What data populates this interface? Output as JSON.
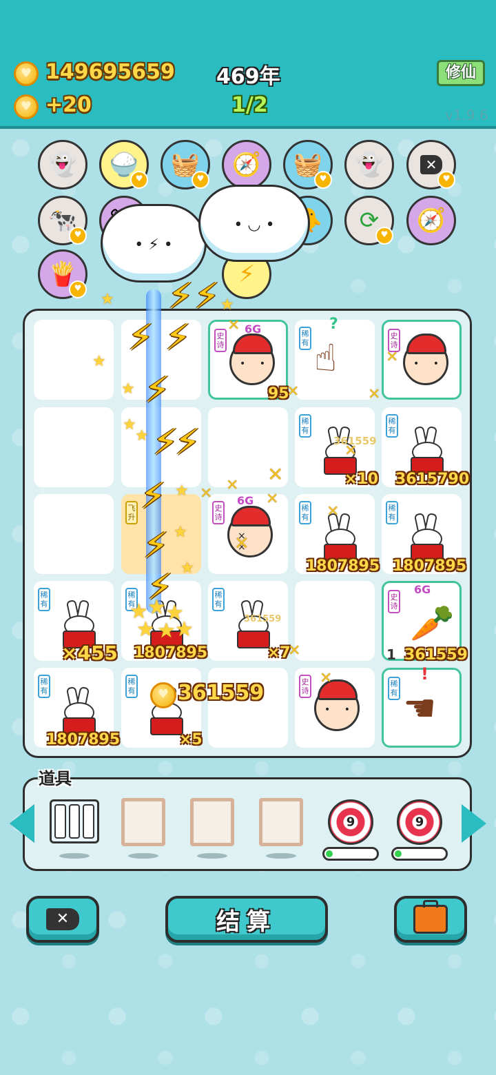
{
  "header": {
    "coins": "149695659",
    "income": "+20",
    "year": "469年",
    "wave": "1/2",
    "cultivate_label": "修仙",
    "version": "v1.9.6"
  },
  "skills": [
    {
      "icon": "ghost-icon",
      "color": "#e9e4e0"
    },
    {
      "icon": "rice-bowl-icon",
      "color": "#fff38a"
    },
    {
      "icon": "fruit-basket-icon",
      "color": "#7fd3ea"
    },
    {
      "icon": "compass-icon",
      "color": "#d3a7e8"
    },
    {
      "icon": "fruit-basket-icon",
      "color": "#7fd3ea"
    },
    {
      "icon": "ghost-icon",
      "color": "#e9e4e0"
    },
    {
      "icon": "close-tag-icon",
      "color": "#e9e4e0"
    },
    {
      "icon": "cows-icon",
      "color": "#e9e4e0"
    },
    {
      "icon": "cow-icon",
      "color": "#d3a7e8"
    },
    {
      "icon": "chick-egg-icon",
      "color": "#7fd3ea"
    },
    {
      "icon": "refresh-icon",
      "color": "#e9e4e0"
    },
    {
      "icon": "compass-icon",
      "color": "#d3a7e8"
    },
    {
      "icon": "fries-icon",
      "color": "#d3a7e8"
    },
    {
      "icon": "lightning-icon",
      "color": "#fff38a"
    }
  ],
  "tags": {
    "rare": "稀有",
    "epic": "史诗",
    "fly": "飞升"
  },
  "board": {
    "cells": [
      {
        "label": "95"
      },
      {
        "label": "361559"
      },
      {
        "label": "×10"
      },
      {
        "label": "3615790"
      },
      {
        "label": "1807895"
      },
      {
        "label": "1807895"
      },
      {
        "label": "×455"
      },
      {
        "label": "1807895"
      },
      {
        "label": "361559"
      },
      {
        "label": "×7"
      },
      {
        "label": "361559"
      },
      {
        "label": "1807895"
      },
      {
        "label": "×5"
      },
      {
        "label": "361559"
      }
    ],
    "sixg": "6G",
    "level_1": "1",
    "question": "?",
    "exclaim": "!"
  },
  "items": {
    "title": "道具",
    "target_counts": [
      "9",
      "9"
    ],
    "progress": [
      0.1,
      0.1
    ]
  },
  "buttons": {
    "settle_label": "结算"
  },
  "colors": {
    "header": "#29bcc0",
    "board_bg": "#dff1f3",
    "coin": "#f5b100"
  }
}
